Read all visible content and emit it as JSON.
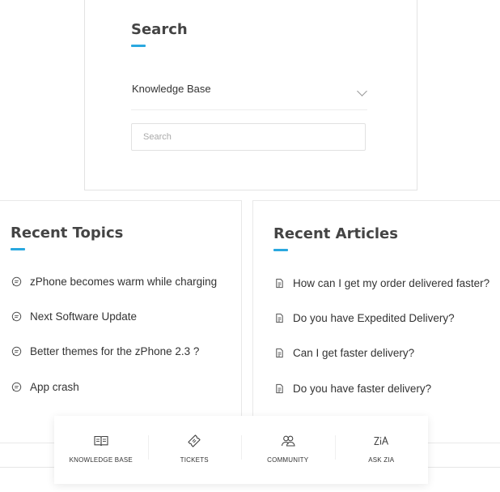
{
  "search": {
    "title": "Search",
    "dropdown_value": "Knowledge Base",
    "input_placeholder": "Search"
  },
  "recent_topics": {
    "title": "Recent Topics",
    "items": [
      {
        "label": "zPhone becomes warm while charging"
      },
      {
        "label": "Next Software Update"
      },
      {
        "label": "Better themes for the zPhone 2.3 ?"
      },
      {
        "label": "App crash"
      }
    ]
  },
  "recent_articles": {
    "title": "Recent Articles",
    "items": [
      {
        "label": "How can I get my order delivered faster?"
      },
      {
        "label": "Do you have Expedited Delivery?"
      },
      {
        "label": "Can I get faster delivery?"
      },
      {
        "label": "Do you have faster delivery?"
      }
    ]
  },
  "tabbar": {
    "tabs": [
      {
        "label": "KNOWLEDGE BASE",
        "icon": "book-icon"
      },
      {
        "label": "TICKETS",
        "icon": "ticket-icon"
      },
      {
        "label": "COMMUNITY",
        "icon": "community-icon"
      },
      {
        "label": "ASK ZIA",
        "icon": "zia-icon"
      }
    ]
  },
  "colors": {
    "accent": "#2aa8df",
    "text": "#333333",
    "border": "#e8e8e8"
  }
}
